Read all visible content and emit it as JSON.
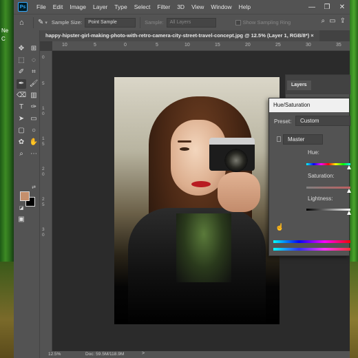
{
  "desktop": {
    "left_chars": [
      "Ne",
      "C"
    ]
  },
  "app": {
    "logo": "Ps",
    "menus": [
      "File",
      "Edit",
      "Image",
      "Layer",
      "Type",
      "Select",
      "Filter",
      "3D",
      "View",
      "Window",
      "Help"
    ],
    "window_controls": [
      "—",
      "❐",
      "✕"
    ]
  },
  "options_bar": {
    "sample_size_label": "Sample Size:",
    "sample_size_value": "Point Sample",
    "sample_label": "Sample:",
    "sample_value": "All Layers",
    "show_ring_label": "Show Sampling Ring"
  },
  "document": {
    "tab_title": "happy-hipster-girl-making-photo-with-retro-camera-city-street-travel-concept.jpg @ 12.5% (Layer 1, RGB/8*) ×"
  },
  "ruler_top": [
    "10",
    "5",
    "0",
    "5",
    "10",
    "15",
    "20",
    "25",
    "30",
    "35"
  ],
  "ruler_left": [
    "0",
    "5",
    "1",
    "0",
    "1",
    "5",
    "2",
    "0",
    "2",
    "5",
    "3",
    "0"
  ],
  "colors": {
    "foreground": "#c58f6c",
    "background": "#000000"
  },
  "layers_panel": {
    "tab": "Layers"
  },
  "hue_saturation": {
    "title": "Hue/Saturation",
    "preset_label": "Preset:",
    "preset_value": "Custom",
    "channel": "Master",
    "hue_label": "Hue:",
    "saturation_label": "Saturation:",
    "lightness_label": "Lightness:"
  },
  "status": {
    "zoom": "12.5%",
    "doc": "Doc: 59.5M/118.9M",
    "arrow": ">"
  }
}
